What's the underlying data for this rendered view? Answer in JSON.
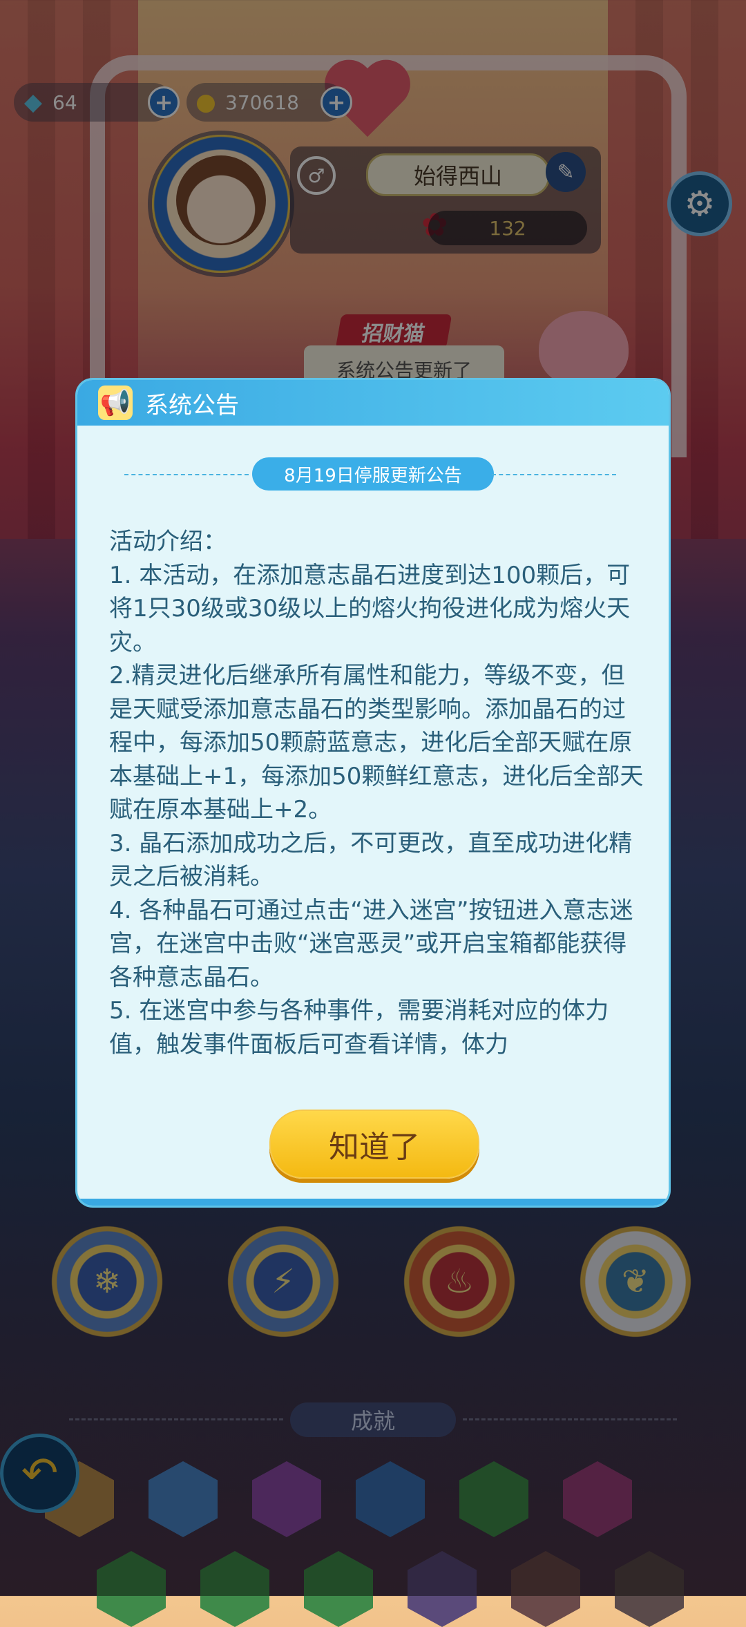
{
  "topbar": {
    "gems": "64",
    "coins": "370618",
    "plus_label": "+"
  },
  "profile": {
    "name": "始得西山",
    "roses": "132",
    "gender_icon": "♂",
    "edit_icon": "✎",
    "settings_icon": "⚙"
  },
  "scene": {
    "banner_label": "招财猫",
    "ticker_text": "系统公告更新了"
  },
  "achievements": {
    "title": "成就"
  },
  "dialog": {
    "title": "系统公告",
    "subtitle": "8月19日停服更新公告",
    "paragraphs": [
      "活动介绍：",
      "1. 本活动，在添加意志晶石进度到达100颗后，可将1只30级或30级以上的熔火拘役进化成为熔火天灾。",
      " 2.精灵进化后继承所有属性和能力，等级不变，但是天赋受添加意志晶石的类型影响。添加晶石的过程中，每添加50颗蔚蓝意志，进化后全部天赋在原本基础上+1，每添加50颗鲜红意志，进化后全部天赋在原本基础上+2。",
      "3. 晶石添加成功之后，不可更改，直至成功进化精灵之后被消耗。",
      "4. 各种晶石可通过点击“进入迷宫”按钮进入意志迷宫，在迷宫中击败“迷宫恶灵”或开启宝箱都能获得各种意志晶石。",
      "5. 在迷宫中参与各种事件，需要消耗对应的体力值，触发事件面板后可查看详情，体力"
    ],
    "confirm_label": "知道了"
  },
  "colors": {
    "dialog_bg": "#e3f6fa",
    "header": "#3aa9e3",
    "text": "#2a5f7a",
    "button": "#ffd84a"
  }
}
